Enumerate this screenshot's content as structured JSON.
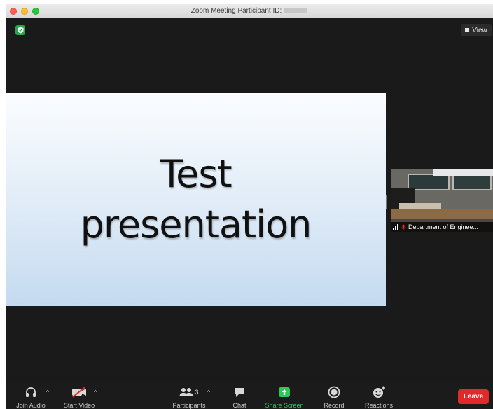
{
  "window": {
    "title": "Zoom Meeting Participant ID:"
  },
  "top": {
    "view_label": "View"
  },
  "slide": {
    "line1": "Test",
    "line2": "presentation"
  },
  "participant": {
    "name": "Department of Enginee..."
  },
  "toolbar": {
    "join_audio": "Join Audio",
    "start_video": "Start Video",
    "participants": "Participants",
    "participants_count": "3",
    "chat": "Chat",
    "share_screen": "Share Screen",
    "record": "Record",
    "reactions": "Reactions",
    "leave": "Leave"
  },
  "icons": {
    "security": "shield-icon",
    "view": "view-icon",
    "join_audio": "headphones-icon",
    "start_video": "video-off-icon",
    "participants": "people-icon",
    "chat": "chat-bubble-icon",
    "share_screen": "share-up-arrow-icon",
    "record": "record-circle-icon",
    "reactions": "emoji-plus-icon"
  },
  "colors": {
    "share_screen": "#2fc65a",
    "leave": "#e02a2a",
    "security": "#25a84a"
  }
}
